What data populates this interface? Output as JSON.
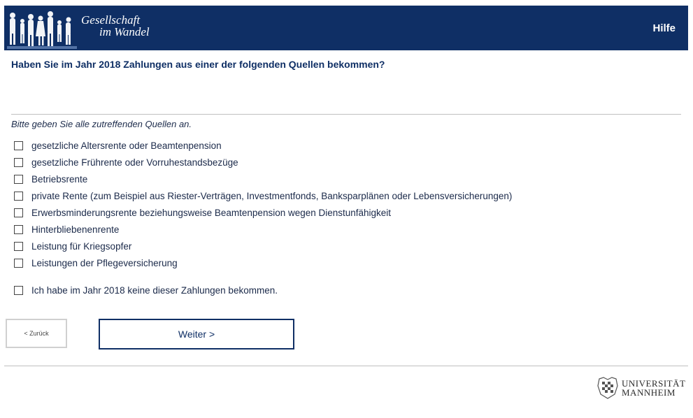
{
  "header": {
    "logo_line1": "Gesellschaft",
    "logo_line2": "im Wandel",
    "help_label": "Hilfe",
    "background": "#0f2f65"
  },
  "question": "Haben Sie im Jahr 2018 Zahlungen aus einer der folgenden Quellen bekommen?",
  "instruction": "Bitte geben Sie alle zutreffenden Quellen an.",
  "options": [
    {
      "label": "gesetzliche Altersrente oder Beamtenpension",
      "checked": false
    },
    {
      "label": "gesetzliche Frührente oder Vorruhestandsbezüge",
      "checked": false
    },
    {
      "label": "Betriebsrente",
      "checked": false
    },
    {
      "label": "private Rente (zum Beispiel aus Riester-Verträgen, Investmentfonds, Banksparplänen oder Lebensversicherungen)",
      "checked": false
    },
    {
      "label": "Erwerbsminderungsrente beziehungsweise Beamtenpension wegen Dienstunfähigkeit",
      "checked": false
    },
    {
      "label": "Hinterbliebenenrente",
      "checked": false
    },
    {
      "label": "Leistung für Kriegsopfer",
      "checked": false
    },
    {
      "label": "Leistungen der Pflegeversicherung",
      "checked": false
    }
  ],
  "none_option": {
    "label": "Ich habe im Jahr 2018 keine dieser Zahlungen bekommen.",
    "checked": false
  },
  "nav": {
    "back_label": "< Zurück",
    "next_label": "Weiter >"
  },
  "footer": {
    "uni_line1": "UNIVERSITÄT",
    "uni_line2": "MANNHEIM"
  }
}
